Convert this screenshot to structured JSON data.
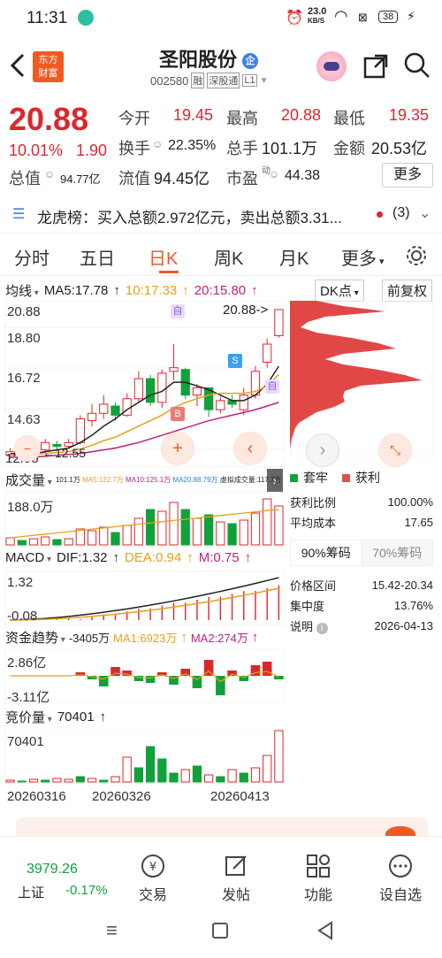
{
  "status_bar": {
    "time": "11:31",
    "speed_top": "23.0",
    "speed_unit": "KB/S",
    "battery": "38"
  },
  "header": {
    "logo_line1": "东方",
    "logo_line2": "财富",
    "title": "圣阳股份",
    "title_badge": "企",
    "code": "002580",
    "tag1": "融",
    "tag2": "深股通",
    "tag3": "L1"
  },
  "quote": {
    "price": "20.88",
    "pct": "10.01%",
    "chg": "1.90",
    "open_label": "今开",
    "open": "19.45",
    "high_label": "最高",
    "high": "20.88",
    "low_label": "最低",
    "low": "19.35",
    "turnover_label": "换手",
    "turnover": "22.35%",
    "volume_label": "总手",
    "volume": "101.1万",
    "amount_label": "金额",
    "amount": "20.53亿",
    "mcap_label": "总值",
    "mcap": "94.77亿",
    "float_label": "流值",
    "float": "94.45亿",
    "pe_label": "市盈",
    "pe_sup": "动",
    "pe": "44.38",
    "more": "更多"
  },
  "lhb": {
    "text": "龙虎榜：买入总额2.972亿元，卖出总额3.31...",
    "count": "(3)"
  },
  "tabs": [
    "分时",
    "五日",
    "日K",
    "周K",
    "月K",
    "更多"
  ],
  "active_tab": 2,
  "kline": {
    "ma_label": "均线",
    "ma5": "MA5:17.78",
    "ma10": "10:17.33",
    "ma20": "20:15.80",
    "dk_label": "DK点",
    "fq_label": "前复权",
    "y_labels": [
      "20.88",
      "18.80",
      "16.72",
      "14.63",
      "12.55"
    ],
    "low_marker": "12.55",
    "high_marker": "20.88",
    "badge_zi": "自",
    "badge_s": "S",
    "badge_b": "B"
  },
  "volume": {
    "label": "成交量",
    "info1": "101.1万",
    "info2": "MA5:122.7万",
    "info3": "MA10:125.1万",
    "info4": "MA20:88.79万",
    "info5": "虚拟成交量:117.7万",
    "ymax": "188.0万"
  },
  "macd": {
    "label": "MACD",
    "dif": "DIF:1.32",
    "dea": "DEA:0.94",
    "m": "M:0.75",
    "ymax": "1.32",
    "ymin": "-0.08"
  },
  "fund": {
    "label": "资金趋势",
    "val": "-3405万",
    "ma1": "MA1:6923万",
    "ma2": "MA2:274万",
    "ymax": "2.86亿",
    "ymin": "-3.11亿"
  },
  "bid": {
    "label": "竞价量",
    "val": "70401",
    "ymax": "70401"
  },
  "dates": [
    "20260316",
    "20260326",
    "20260413"
  ],
  "chip": {
    "legend1": "套牢",
    "legend2": "获利",
    "profit_label": "获利比例",
    "profit": "100.00%",
    "cost_label": "平均成本",
    "cost": "17.65",
    "tab90": "90%筹码",
    "tab70": "70%筹码",
    "range_label": "价格区间",
    "range": "15.42-20.34",
    "conc_label": "集中度",
    "conc": "13.76%",
    "note_label": "说明",
    "note": "2026-04-13"
  },
  "bottom": {
    "index_val": "3979.26",
    "index_name": "上证",
    "index_pct": "-0.17%",
    "btn1": "交易",
    "btn2": "发帖",
    "btn3": "功能",
    "btn4": "设自选"
  },
  "colors": {
    "up": "#e0252d",
    "down": "#11a13b",
    "accent": "#f05a22"
  }
}
